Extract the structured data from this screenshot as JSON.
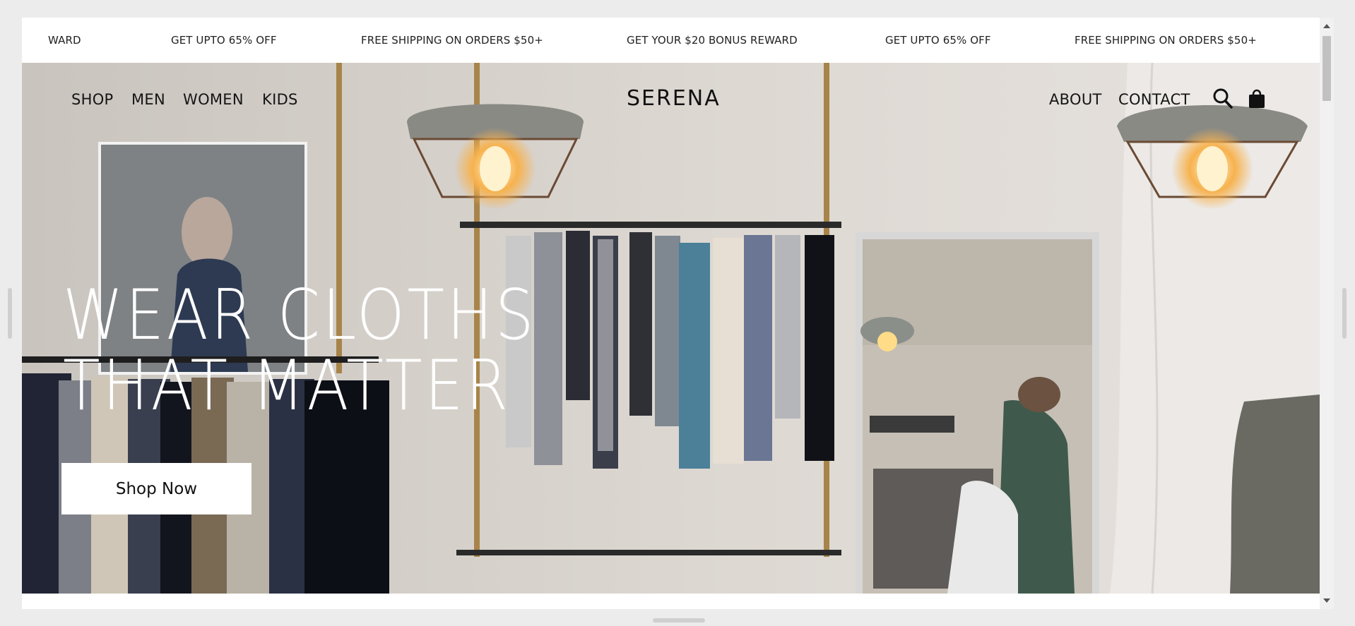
{
  "announcement": {
    "items": [
      "WARD",
      "GET UPTO 65% OFF",
      "FREE SHIPPING ON ORDERS $50+",
      "GET YOUR $20 BONUS REWARD",
      "GET UPTO 65% OFF",
      "FREE SHIPPING ON ORDERS $50+"
    ]
  },
  "nav": {
    "left": [
      "SHOP",
      "MEN",
      "WOMEN",
      "KIDS"
    ],
    "brand": "SERENA",
    "right": [
      "ABOUT",
      "CONTACT"
    ],
    "icons": [
      "search-icon",
      "shopping-bag-icon"
    ]
  },
  "hero": {
    "headline_line1": "WEAR CLOTHS",
    "headline_line2": "THAT MATTER",
    "cta_label": "Shop Now"
  },
  "colors": {
    "text": "#151515",
    "cta_background": "#ffffff",
    "page_background": "#ececec"
  }
}
